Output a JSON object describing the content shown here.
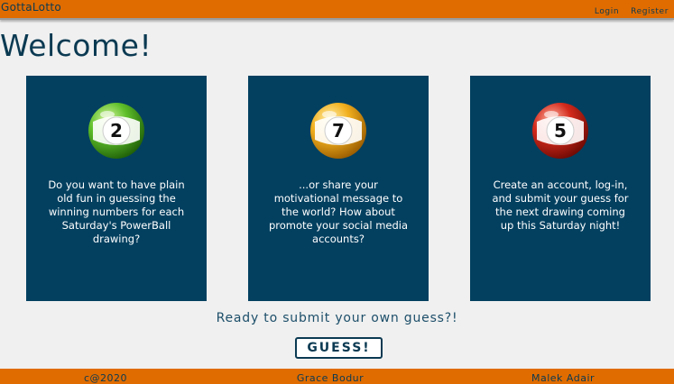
{
  "navbar": {
    "brand": "GottaLotto",
    "links": [
      "Login",
      "Register"
    ]
  },
  "page": {
    "title": "Welcome!"
  },
  "cards": [
    {
      "ball_number": "2",
      "ball_color": "#5fbf2a",
      "text": "Do you want to have plain old fun in guessing the winning numbers for each Saturday's PowerBall drawing?"
    },
    {
      "ball_number": "7",
      "ball_color": "#f2b01e",
      "text": "...or share your motivational message to the world? How about promote your social media accounts?"
    },
    {
      "ball_number": "5",
      "ball_color": "#d42a1c",
      "text": "Create an account, log-in, and submit your guess for the next drawing coming up this Saturday night!"
    }
  ],
  "cta": {
    "text": "Ready to submit your own guess?!",
    "button_label": "GUESS!"
  },
  "footer": {
    "items": [
      "c@2020",
      "Grace Bodur",
      "Malek Adair"
    ]
  },
  "colors": {
    "accent": "#e06c00",
    "card_bg": "#034060",
    "text_dark": "#0b3a52"
  }
}
